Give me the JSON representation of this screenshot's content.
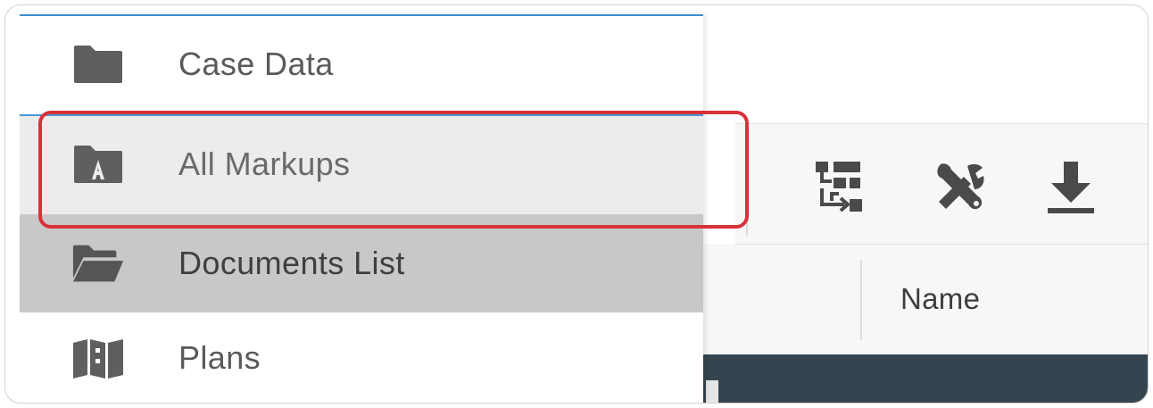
{
  "menu": {
    "items": [
      {
        "label": "Case Data",
        "icon": "folder-icon",
        "state": "normal"
      },
      {
        "label": "All Markups",
        "icon": "markup-folder-icon",
        "state": "hovered"
      },
      {
        "label": "Documents List",
        "icon": "open-folder-icon",
        "state": "active"
      },
      {
        "label": "Plans",
        "icon": "map-icon",
        "state": "normal"
      }
    ]
  },
  "toolbar": {
    "tools": [
      {
        "icon": "workflow-icon"
      },
      {
        "icon": "tools-icon"
      },
      {
        "icon": "download-icon"
      }
    ]
  },
  "table": {
    "columns": [
      "Name"
    ]
  },
  "colors": {
    "highlight": "#d8313a",
    "accent_line": "#3b8fd1",
    "icon_gray": "#5f5f5f",
    "label_gray": "#5a5a5a",
    "active_bg": "#c8c8c8",
    "hover_bg": "#ececec",
    "dark_strip": "#35454f"
  }
}
